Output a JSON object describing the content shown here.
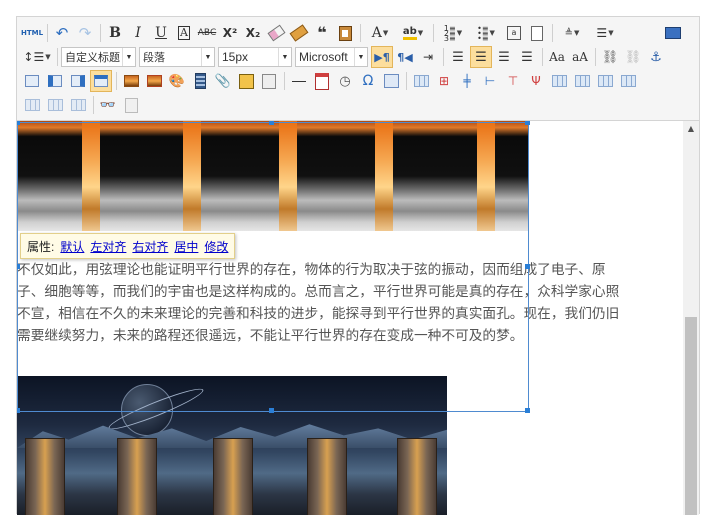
{
  "toolbar": {
    "row1": [
      "html",
      "undo",
      "redo",
      "bold",
      "italic",
      "underline",
      "font-border",
      "strikethrough",
      "superscript",
      "subscript",
      "remove-format",
      "format-match",
      "blockquote",
      "paste-plain",
      "fore-color",
      "back-color",
      "ordered-list",
      "unordered-list",
      "select-all",
      "clear-doc",
      "row-spacing-top",
      "row-spacing-bottom",
      "preview"
    ],
    "row2": {
      "custom_style": "自定义标题",
      "paragraph": "段落",
      "font_size": "15px",
      "font_family": "Microsoft",
      "buttons": [
        "direction-ltr",
        "direction-rtl",
        "indent",
        "justify-left",
        "justify-center",
        "justify-right",
        "justify-justify",
        "to-uppercase",
        "to-lowercase",
        "link",
        "unlink",
        "anchor"
      ]
    },
    "row3": [
      "image-none",
      "image-left",
      "image-right",
      "image-center",
      "simple-upload",
      "insert-image",
      "emotion",
      "scrawl",
      "insert-video",
      "attachment",
      "insert-frame",
      "insert-code",
      "horizontal",
      "date",
      "time",
      "spechars",
      "wordimage",
      "insert-table",
      "insert-row",
      "insert-col",
      "merge-right",
      "merge-down",
      "delete-row",
      "delete-col",
      "split-to-cells",
      "split-to-rows"
    ],
    "row4": [
      "split-to-cols",
      "insert-paragraph-before-table",
      "delete-table",
      "search-replace",
      "template"
    ]
  },
  "popup": {
    "label": "属性:",
    "links": [
      "默认",
      "左对齐",
      "右对齐",
      "居中",
      "修改"
    ]
  },
  "content": {
    "paragraph_lines": [
      "不仅如此，用弦理论也能证明平行世界的存在，物体的行为取决于弦的振动，因而组成了电子、原",
      "子、细胞等等，而我们的宇宙也是这样构成的。总而言之，平行世界可能是真的存在，众科学家心照",
      "不宣，相信在不久的未来理论的完善和科技的进步，能探寻到平行世界的真实面孔。现在，我们仍旧",
      "需要继续努力，未来的路程还很遥远，不能让平行世界的存在变成一种不可及的梦。"
    ]
  },
  "colors": {
    "toolbar_bg": "#f5f5f5",
    "active_button": "#fcde9d",
    "selection": "#4f8bd0",
    "link": "#0000cc",
    "text": "#555555"
  }
}
